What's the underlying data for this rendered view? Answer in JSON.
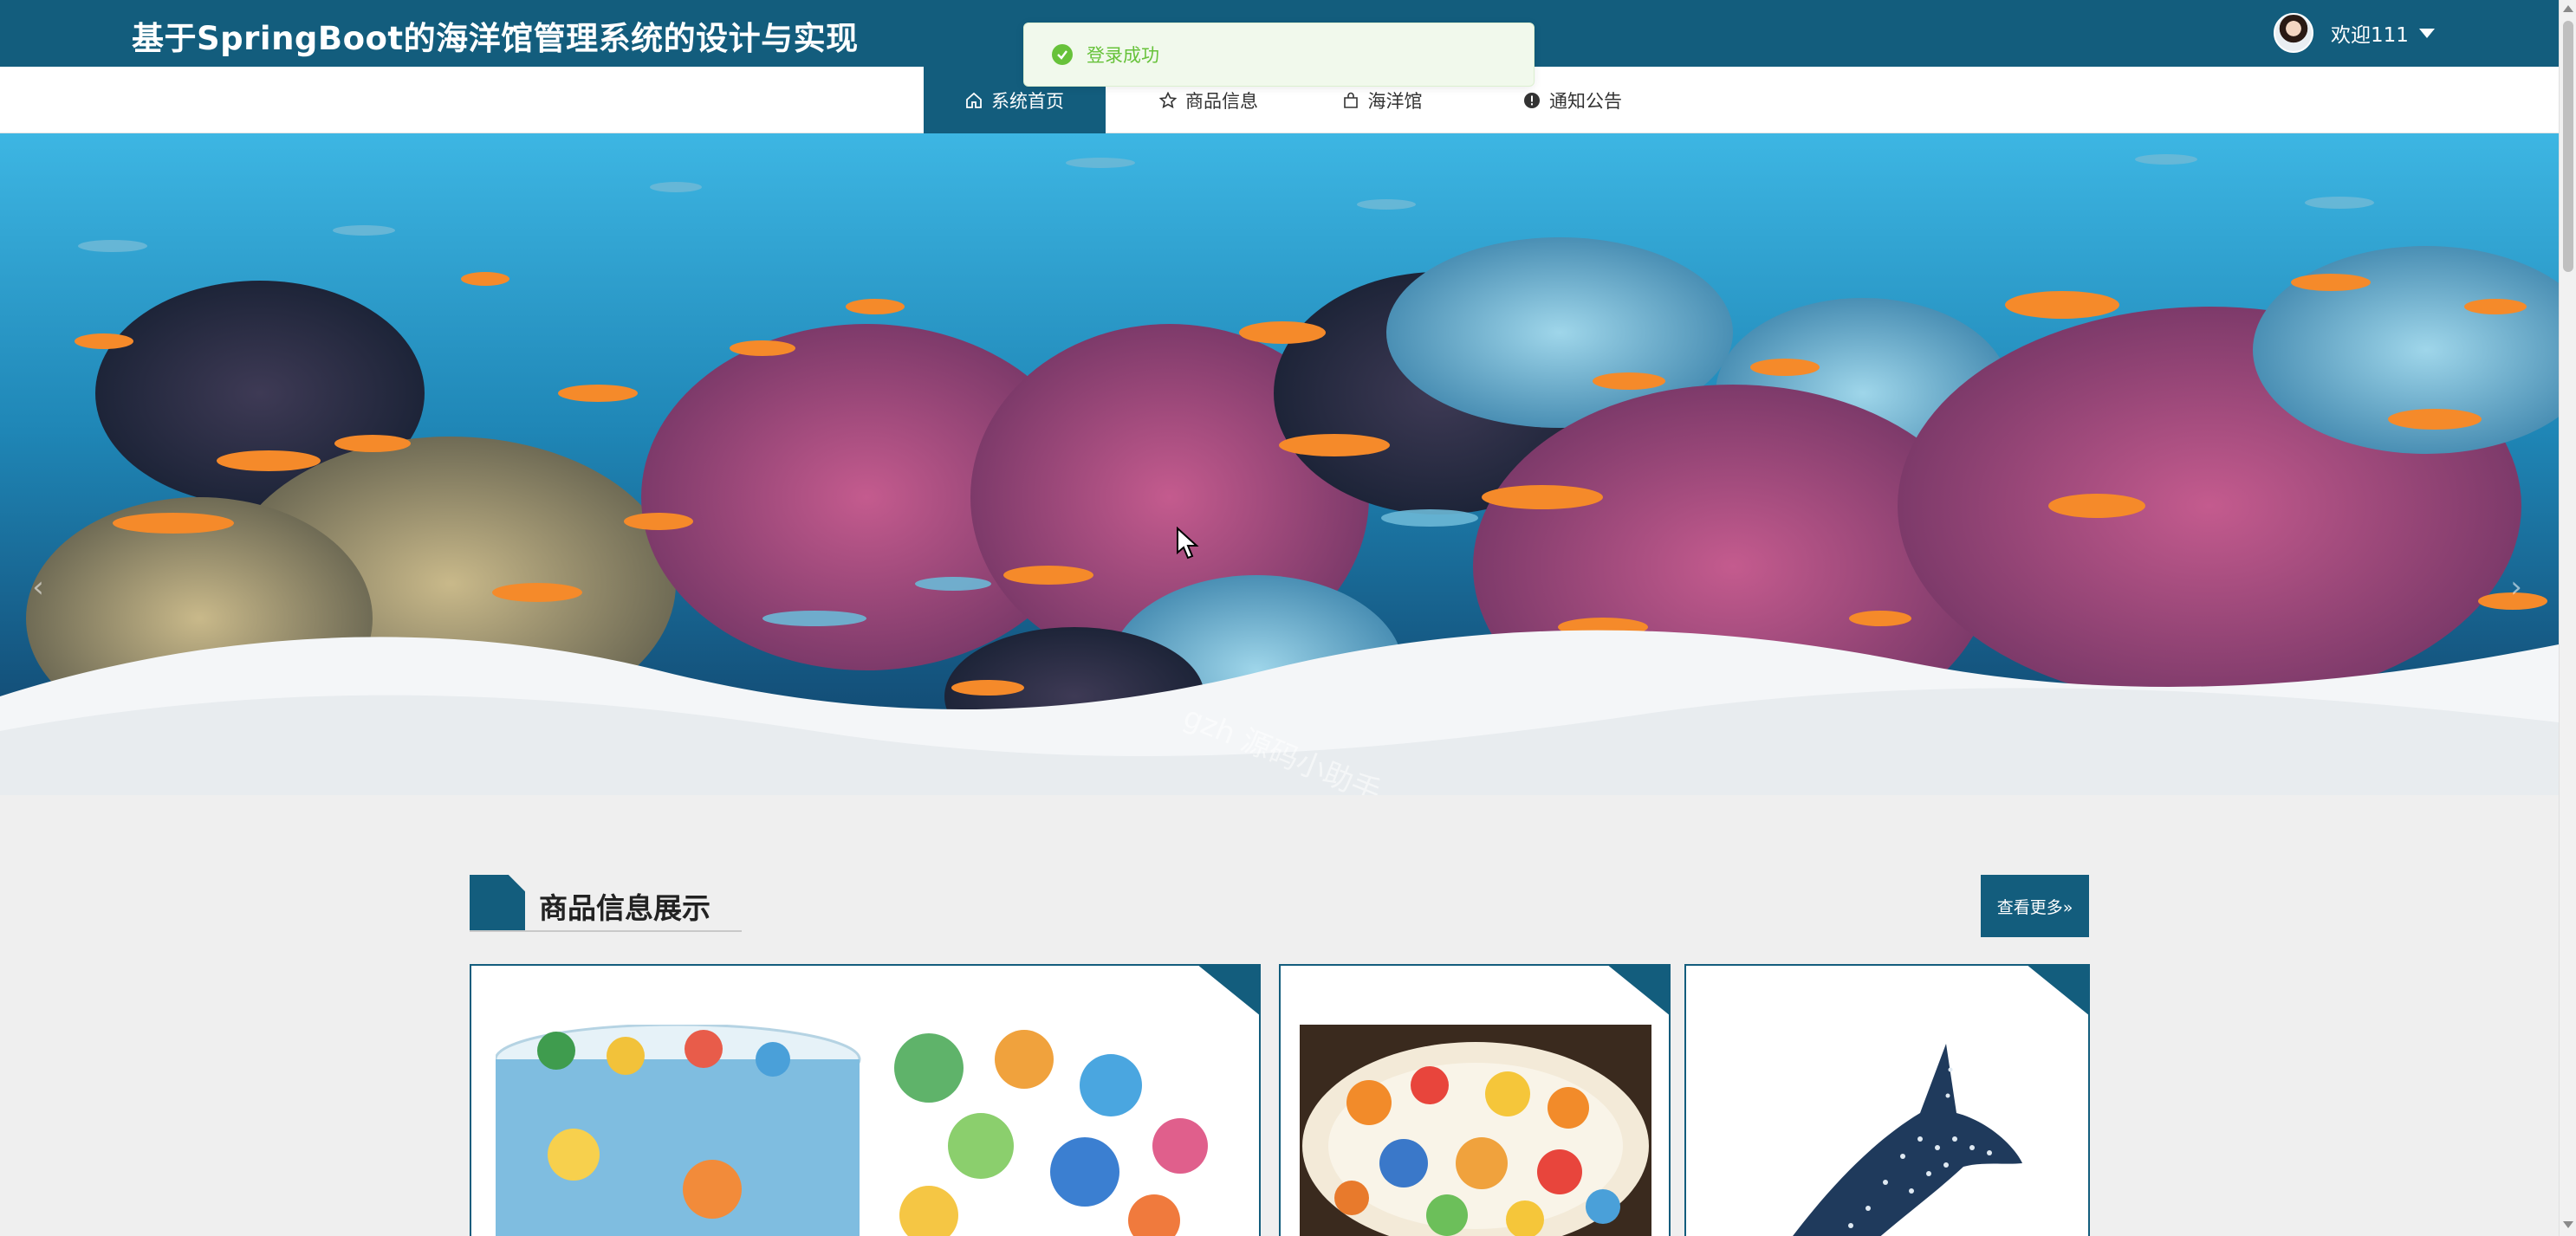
{
  "header": {
    "title": "基于SpringBoot的海洋馆管理系统的设计与实现",
    "welcome": "欢迎111",
    "avatar_icon": "user-avatar",
    "dropdown_icon": "caret-down-icon"
  },
  "nav": {
    "items": [
      {
        "label": "系统首页",
        "icon": "home-icon",
        "active": true
      },
      {
        "label": "商品信息",
        "icon": "star-icon",
        "active": false
      },
      {
        "label": "海洋馆",
        "icon": "bag-icon",
        "active": false
      },
      {
        "label": "通知公告",
        "icon": "info-icon",
        "active": false
      }
    ]
  },
  "toast": {
    "message": "登录成功",
    "icon": "success-check-icon",
    "color": "#67c23a"
  },
  "banner": {
    "watermark": "gzh 源码小助手"
  },
  "section": {
    "title": "商品信息展示",
    "more_label": "查看更多»"
  },
  "theme": {
    "primary": "#135d7d",
    "background": "#efefef"
  }
}
